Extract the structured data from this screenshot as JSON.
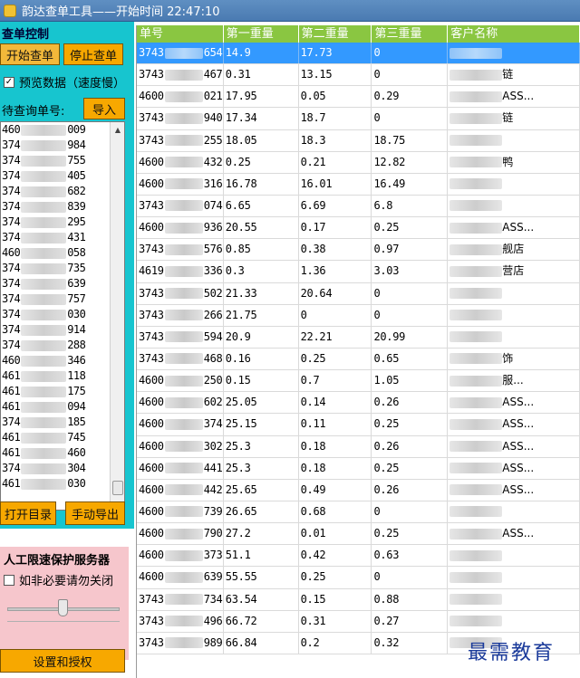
{
  "window": {
    "title": "韵达查单工具——开始时间 22:47:10"
  },
  "controls": {
    "group_title": "查单控制",
    "start_label": "开始查单",
    "stop_label": "停止查单",
    "preview_label": "预览数据（速度慢）",
    "preview_checked": true,
    "pending_label": "待查询单号:",
    "import_label": "导入",
    "open_dir_label": "打开目录",
    "manual_export_label": "手动导出",
    "settings_label": "设置和授权"
  },
  "pending_list": [
    {
      "prefix": "460",
      "suffix": "009"
    },
    {
      "prefix": "374",
      "suffix": "984"
    },
    {
      "prefix": "374",
      "suffix": "755"
    },
    {
      "prefix": "374",
      "suffix": "405"
    },
    {
      "prefix": "374",
      "suffix": "682"
    },
    {
      "prefix": "374",
      "suffix": "839"
    },
    {
      "prefix": "374",
      "suffix": "295"
    },
    {
      "prefix": "374",
      "suffix": "431"
    },
    {
      "prefix": "460",
      "suffix": "058"
    },
    {
      "prefix": "374",
      "suffix": "735"
    },
    {
      "prefix": "374",
      "suffix": "639"
    },
    {
      "prefix": "374",
      "suffix": "757"
    },
    {
      "prefix": "374",
      "suffix": "030"
    },
    {
      "prefix": "374",
      "suffix": "914"
    },
    {
      "prefix": "374",
      "suffix": "288"
    },
    {
      "prefix": "460",
      "suffix": "346"
    },
    {
      "prefix": "461",
      "suffix": "118"
    },
    {
      "prefix": "461",
      "suffix": "175"
    },
    {
      "prefix": "461",
      "suffix": "094"
    },
    {
      "prefix": "374",
      "suffix": "185"
    },
    {
      "prefix": "461",
      "suffix": "745"
    },
    {
      "prefix": "461",
      "suffix": "460"
    },
    {
      "prefix": "374",
      "suffix": "304"
    },
    {
      "prefix": "461",
      "suffix": "030"
    }
  ],
  "protection": {
    "title": "人工限速保护服务器",
    "checkbox_label": "如非必要请勿关闭",
    "checked": false,
    "slider_level": 0.5
  },
  "table": {
    "headers": [
      "单号",
      "第一重量",
      "第二重量",
      "第三重量",
      "客户名称"
    ],
    "rows": [
      {
        "pre": "3743",
        "suf": "654",
        "w1": "14.9",
        "w2": "17.73",
        "w3": "0",
        "name": "",
        "selected": true
      },
      {
        "pre": "3743",
        "suf": "467",
        "w1": "0.31",
        "w2": "13.15",
        "w3": "0",
        "name": "链"
      },
      {
        "pre": "4600",
        "suf": "021",
        "w1": "17.95",
        "w2": "0.05",
        "w3": "0.29",
        "name": "ASS..."
      },
      {
        "pre": "3743",
        "suf": "940",
        "w1": "17.34",
        "w2": "18.7",
        "w3": "0",
        "name": "链"
      },
      {
        "pre": "3743",
        "suf": "255",
        "w1": "18.05",
        "w2": "18.3",
        "w3": "18.75",
        "name": ""
      },
      {
        "pre": "4600",
        "suf": "432",
        "w1": "0.25",
        "w2": "0.21",
        "w3": "12.82",
        "name": "鸭"
      },
      {
        "pre": "4600",
        "suf": "316",
        "w1": "16.78",
        "w2": "16.01",
        "w3": "16.49",
        "name": ""
      },
      {
        "pre": "3743",
        "suf": "074",
        "w1": "6.65",
        "w2": "6.69",
        "w3": "6.8",
        "name": ""
      },
      {
        "pre": "4600",
        "suf": "936",
        "w1": "20.55",
        "w2": "0.17",
        "w3": "0.25",
        "name": "ASS..."
      },
      {
        "pre": "3743",
        "suf": "576",
        "w1": "0.85",
        "w2": "0.38",
        "w3": "0.97",
        "name": "舰店"
      },
      {
        "pre": "4619",
        "suf": "336",
        "w1": "0.3",
        "w2": "1.36",
        "w3": "3.03",
        "name": "营店"
      },
      {
        "pre": "3743",
        "suf": "502",
        "w1": "21.33",
        "w2": "20.64",
        "w3": "0",
        "name": ""
      },
      {
        "pre": "3743",
        "suf": "266",
        "w1": "21.75",
        "w2": "0",
        "w3": "0",
        "name": ""
      },
      {
        "pre": "3743",
        "suf": "594",
        "w1": "20.9",
        "w2": "22.21",
        "w3": "20.99",
        "name": ""
      },
      {
        "pre": "3743",
        "suf": "468",
        "w1": "0.16",
        "w2": "0.25",
        "w3": "0.65",
        "name": "饰"
      },
      {
        "pre": "4600",
        "suf": "250",
        "w1": "0.15",
        "w2": "0.7",
        "w3": "1.05",
        "name": "服..."
      },
      {
        "pre": "4600",
        "suf": "602",
        "w1": "25.05",
        "w2": "0.14",
        "w3": "0.26",
        "name": "ASS..."
      },
      {
        "pre": "4600",
        "suf": "374",
        "w1": "25.15",
        "w2": "0.11",
        "w3": "0.25",
        "name": "ASS..."
      },
      {
        "pre": "4600",
        "suf": "302",
        "w1": "25.3",
        "w2": "0.18",
        "w3": "0.26",
        "name": "ASS..."
      },
      {
        "pre": "4600",
        "suf": "441",
        "w1": "25.3",
        "w2": "0.18",
        "w3": "0.25",
        "name": "ASS..."
      },
      {
        "pre": "4600",
        "suf": "442",
        "w1": "25.65",
        "w2": "0.49",
        "w3": "0.26",
        "name": "ASS..."
      },
      {
        "pre": "4600",
        "suf": "739",
        "w1": "26.65",
        "w2": "0.68",
        "w3": "0",
        "name": ""
      },
      {
        "pre": "4600",
        "suf": "790",
        "w1": "27.2",
        "w2": "0.01",
        "w3": "0.25",
        "name": "ASS..."
      },
      {
        "pre": "4600",
        "suf": "373",
        "w1": "51.1",
        "w2": "0.42",
        "w3": "0.63",
        "name": ""
      },
      {
        "pre": "4600",
        "suf": "639",
        "w1": "55.55",
        "w2": "0.25",
        "w3": "0",
        "name": ""
      },
      {
        "pre": "3743",
        "suf": "734",
        "w1": "63.54",
        "w2": "0.15",
        "w3": "0.88",
        "name": ""
      },
      {
        "pre": "3743",
        "suf": "496",
        "w1": "66.72",
        "w2": "0.31",
        "w3": "0.27",
        "name": ""
      },
      {
        "pre": "3743",
        "suf": "989",
        "w1": "66.84",
        "w2": "0.2",
        "w3": "0.32",
        "name": ""
      }
    ]
  },
  "watermark": "最需教育"
}
